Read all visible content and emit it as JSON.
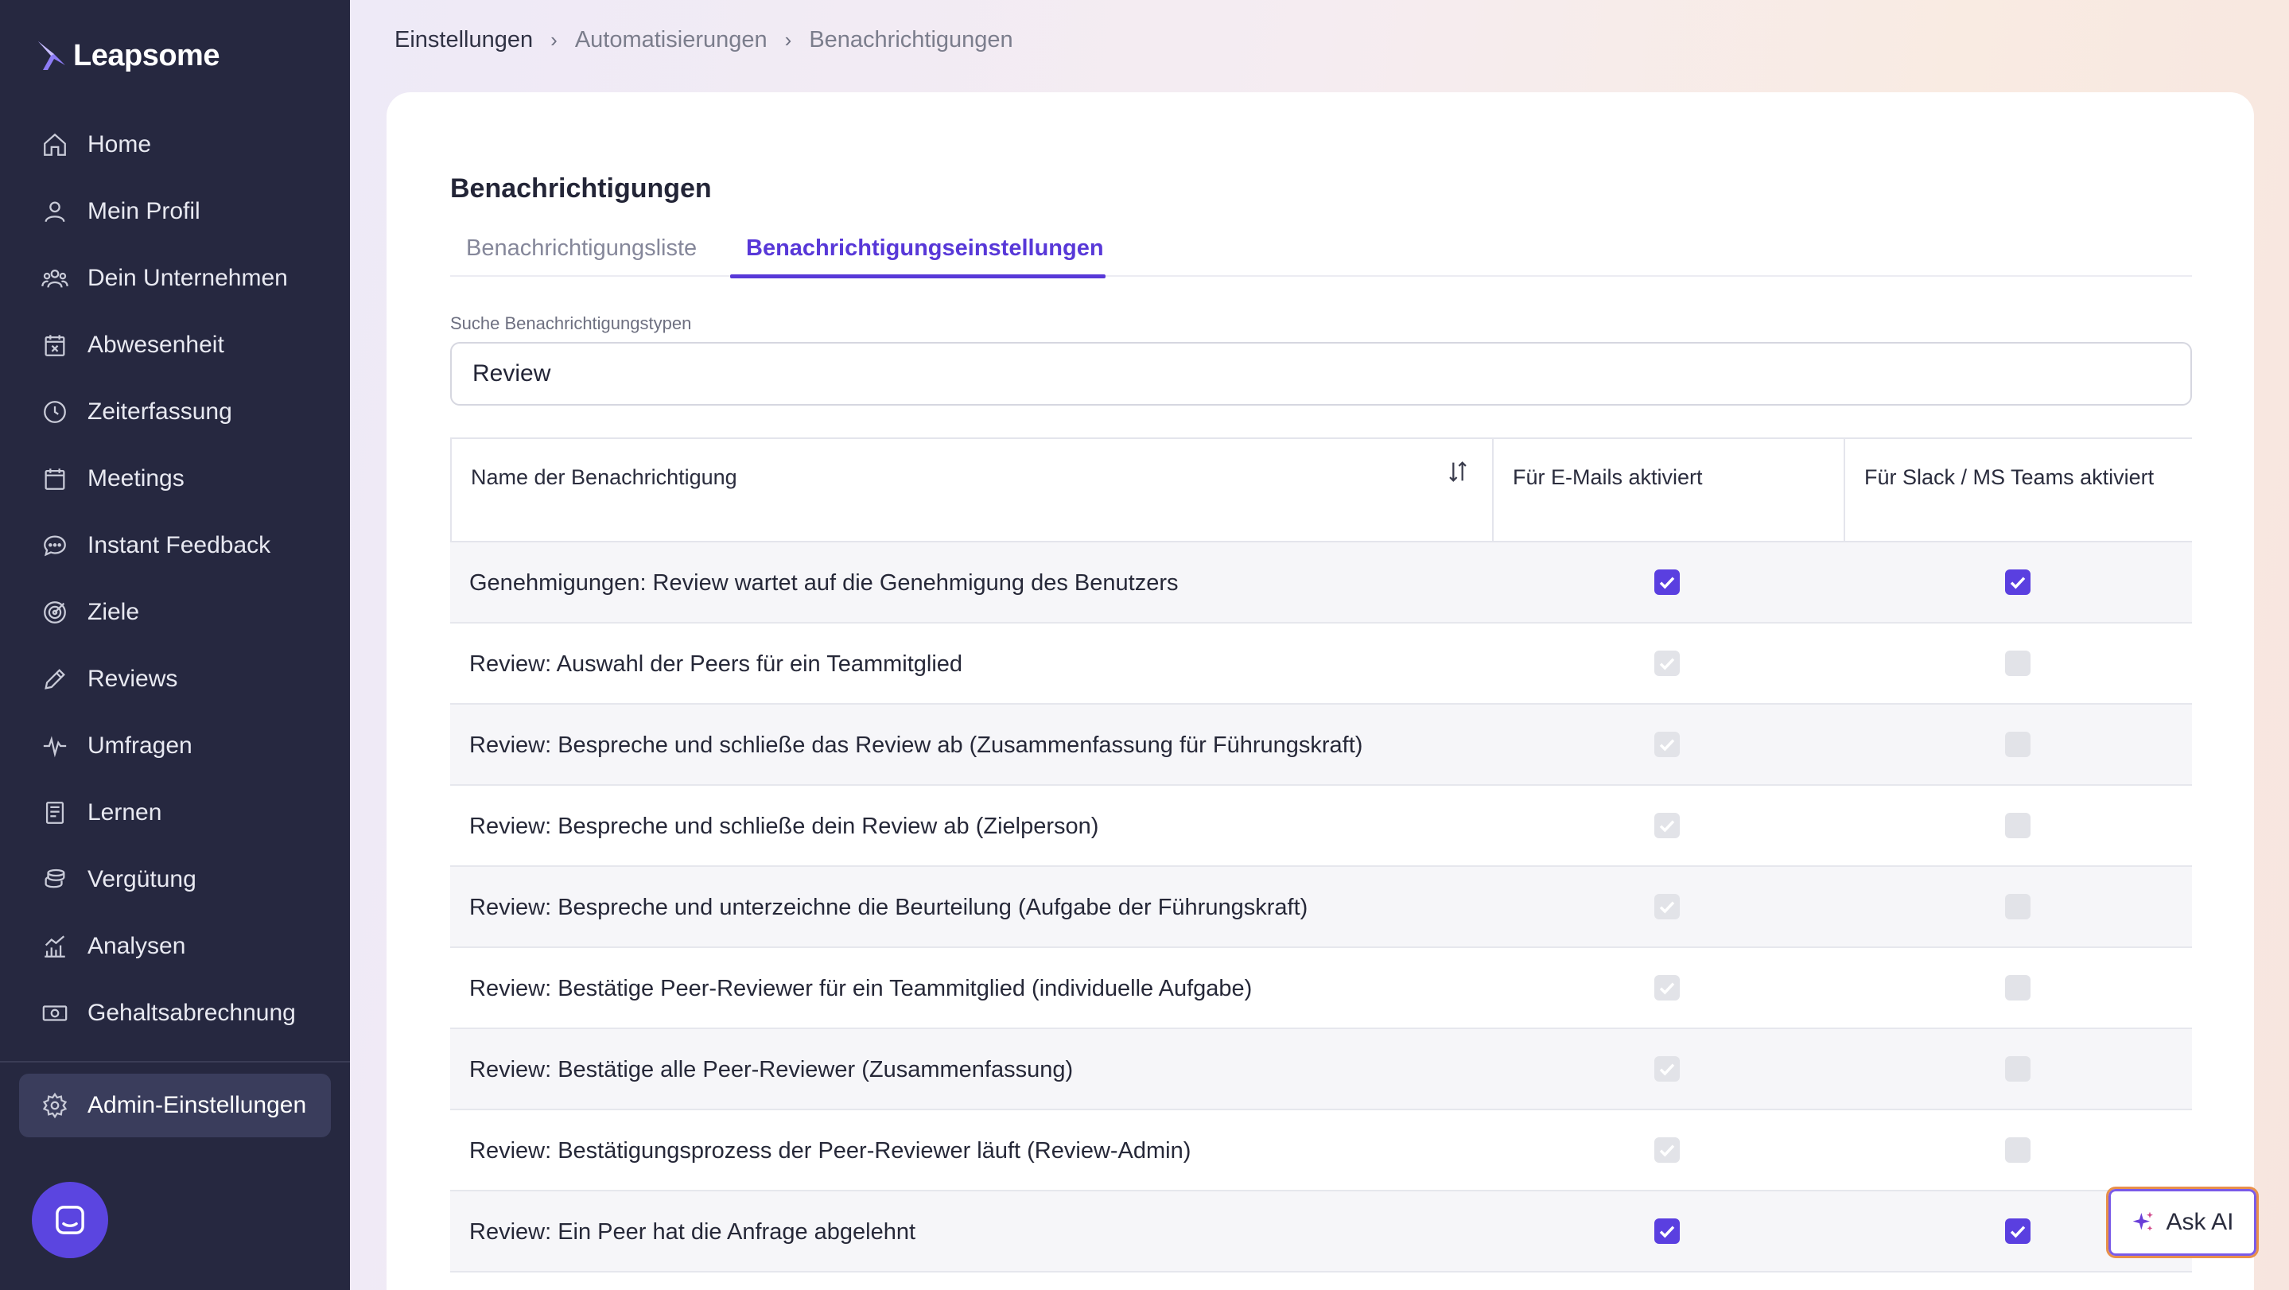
{
  "brand": {
    "name": "Leapsome",
    "accent": "#5838d8",
    "sidebar_bg": "#262840"
  },
  "sidebar": {
    "items": [
      {
        "label": "Home",
        "icon": "home-icon"
      },
      {
        "label": "Mein Profil",
        "icon": "user-icon"
      },
      {
        "label": "Dein Unternehmen",
        "icon": "users-icon"
      },
      {
        "label": "Abwesenheit",
        "icon": "calendar-x-icon"
      },
      {
        "label": "Zeiterfassung",
        "icon": "clock-icon"
      },
      {
        "label": "Meetings",
        "icon": "calendar-icon"
      },
      {
        "label": "Instant Feedback",
        "icon": "chat-icon"
      },
      {
        "label": "Ziele",
        "icon": "target-icon"
      },
      {
        "label": "Reviews",
        "icon": "pencil-icon"
      },
      {
        "label": "Umfragen",
        "icon": "pulse-icon"
      },
      {
        "label": "Lernen",
        "icon": "book-icon"
      },
      {
        "label": "Vergütung",
        "icon": "coins-icon"
      },
      {
        "label": "Analysen",
        "icon": "chart-icon"
      },
      {
        "label": "Gehaltsabrechnung",
        "icon": "money-icon"
      }
    ],
    "admin_label": "Admin-Einstellungen"
  },
  "breadcrumb": [
    "Einstellungen",
    "Automatisierungen",
    "Benachrichtigungen"
  ],
  "page": {
    "title": "Benachrichtigungen",
    "tabs": [
      "Benachrichtigungsliste",
      "Benachrichtigungseinstellungen"
    ],
    "active_tab": "Benachrichtigungseinstellungen",
    "search_label": "Suche Benachrichtigungstypen",
    "search_value": "Review"
  },
  "table": {
    "headers": {
      "name": "Name der Benachrichtigung",
      "email": "Für E-Mails aktiviert",
      "slack": "Für Slack / MS Teams aktiviert"
    },
    "rows": [
      {
        "name": "Genehmigungen: Review wartet auf die Genehmigung des Benutzers",
        "email": "checked",
        "slack": "checked"
      },
      {
        "name": "Review: Auswahl der Peers für ein Teammitglied",
        "email": "disabled-checked",
        "slack": "disabled-unchecked"
      },
      {
        "name": "Review: Bespreche und schließe das Review ab (Zusammenfassung für Führungskraft)",
        "email": "disabled-checked",
        "slack": "disabled-unchecked"
      },
      {
        "name": "Review: Bespreche und schließe dein Review ab (Zielperson)",
        "email": "disabled-checked",
        "slack": "disabled-unchecked"
      },
      {
        "name": "Review: Bespreche und unterzeichne die Beurteilung (Aufgabe der Führungskraft)",
        "email": "disabled-checked",
        "slack": "disabled-unchecked"
      },
      {
        "name": "Review: Bestätige Peer-Reviewer für ein Teammitglied (individuelle Aufgabe)",
        "email": "disabled-checked",
        "slack": "disabled-unchecked"
      },
      {
        "name": "Review: Bestätige alle Peer-Reviewer (Zusammenfassung)",
        "email": "disabled-checked",
        "slack": "disabled-unchecked"
      },
      {
        "name": "Review: Bestätigungsprozess der Peer-Reviewer läuft (Review-Admin)",
        "email": "disabled-checked",
        "slack": "disabled-unchecked"
      },
      {
        "name": "Review: Ein Peer hat die Anfrage abgelehnt",
        "email": "checked",
        "slack": "checked"
      }
    ]
  },
  "ask_ai": {
    "label": "Ask AI",
    "icon": "sparkle-icon"
  }
}
